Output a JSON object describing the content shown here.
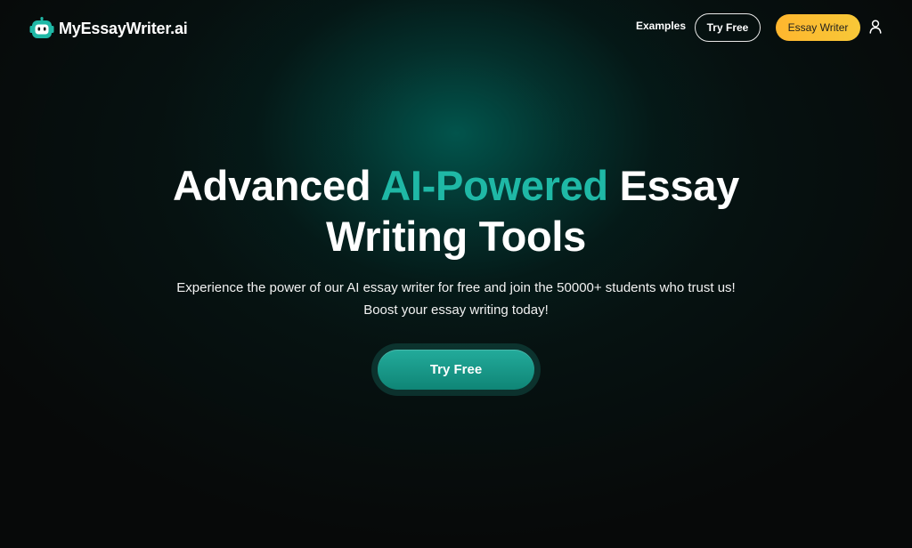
{
  "header": {
    "logo_text": "MyEssayWriter.ai",
    "nav_examples": "Examples",
    "nav_try_free": "Try Free",
    "nav_essay_writer": "Essay Writer",
    "user_icon": "user-icon",
    "logo_icon": "robot-icon"
  },
  "hero": {
    "title_part1": "Advanced ",
    "title_accent": "AI-Powered",
    "title_part2": " Essay",
    "title_line2": "Writing Tools",
    "subtitle_line1": "Experience the power of our AI essay writer for free and join the 50000+ students who trust us!",
    "subtitle_line2": "Boost your essay writing today!",
    "cta_label": "Try Free"
  },
  "colors": {
    "background": "#070909",
    "accent": "#1fb8a6",
    "cta": "#1a9e8e",
    "essay_writer_button": "#ffbb30"
  }
}
